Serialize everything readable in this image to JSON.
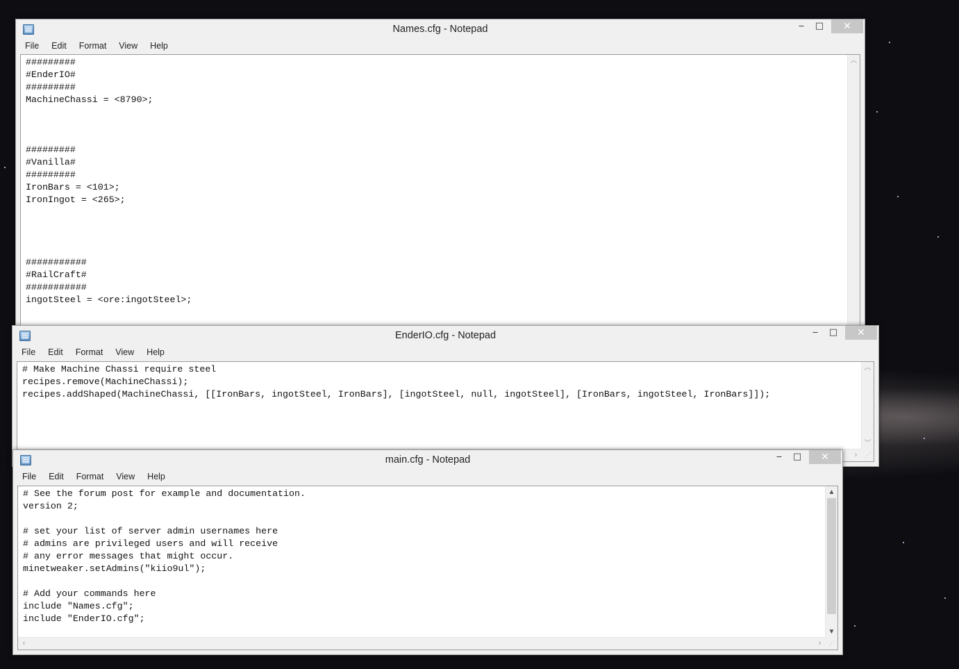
{
  "menu": [
    "File",
    "Edit",
    "Format",
    "View",
    "Help"
  ],
  "window_controls": {
    "minimize": "‒",
    "maximize": "□",
    "close": "✕"
  },
  "windows": {
    "names": {
      "title": "Names.cfg - Notepad",
      "content": "#########\n#EnderIO#\n#########\nMachineChassi = <8790>;\n\n\n\n#########\n#Vanilla#\n#########\nIronBars = <101>;\nIronIngot = <265>;\n\n\n\n\n###########\n#RailCraft#\n###########\ningotSteel = <ore:ingotSteel>;"
    },
    "enderio": {
      "title": "EnderIO.cfg - Notepad",
      "content": "# Make Machine Chassi require steel\nrecipes.remove(MachineChassi);\nrecipes.addShaped(MachineChassi, [[IronBars, ingotSteel, IronBars], [ingotSteel, null, ingotSteel], [IronBars, ingotSteel, IronBars]]);"
    },
    "main": {
      "title": "main.cfg - Notepad",
      "content": "# See the forum post for example and documentation.\nversion 2;\n\n# set your list of server admin usernames here\n# admins are privileged users and will receive\n# any error messages that might occur.\nminetweaker.setAdmins(\"kiio9ul\");\n\n# Add your commands here\ninclude \"Names.cfg\";\ninclude \"EnderIO.cfg\";"
    }
  },
  "colors": {
    "desktop": "#0e0e12",
    "window_chrome": "#f0f0f0",
    "close_button": "#c7c7c7",
    "editor_bg": "#ffffff"
  }
}
